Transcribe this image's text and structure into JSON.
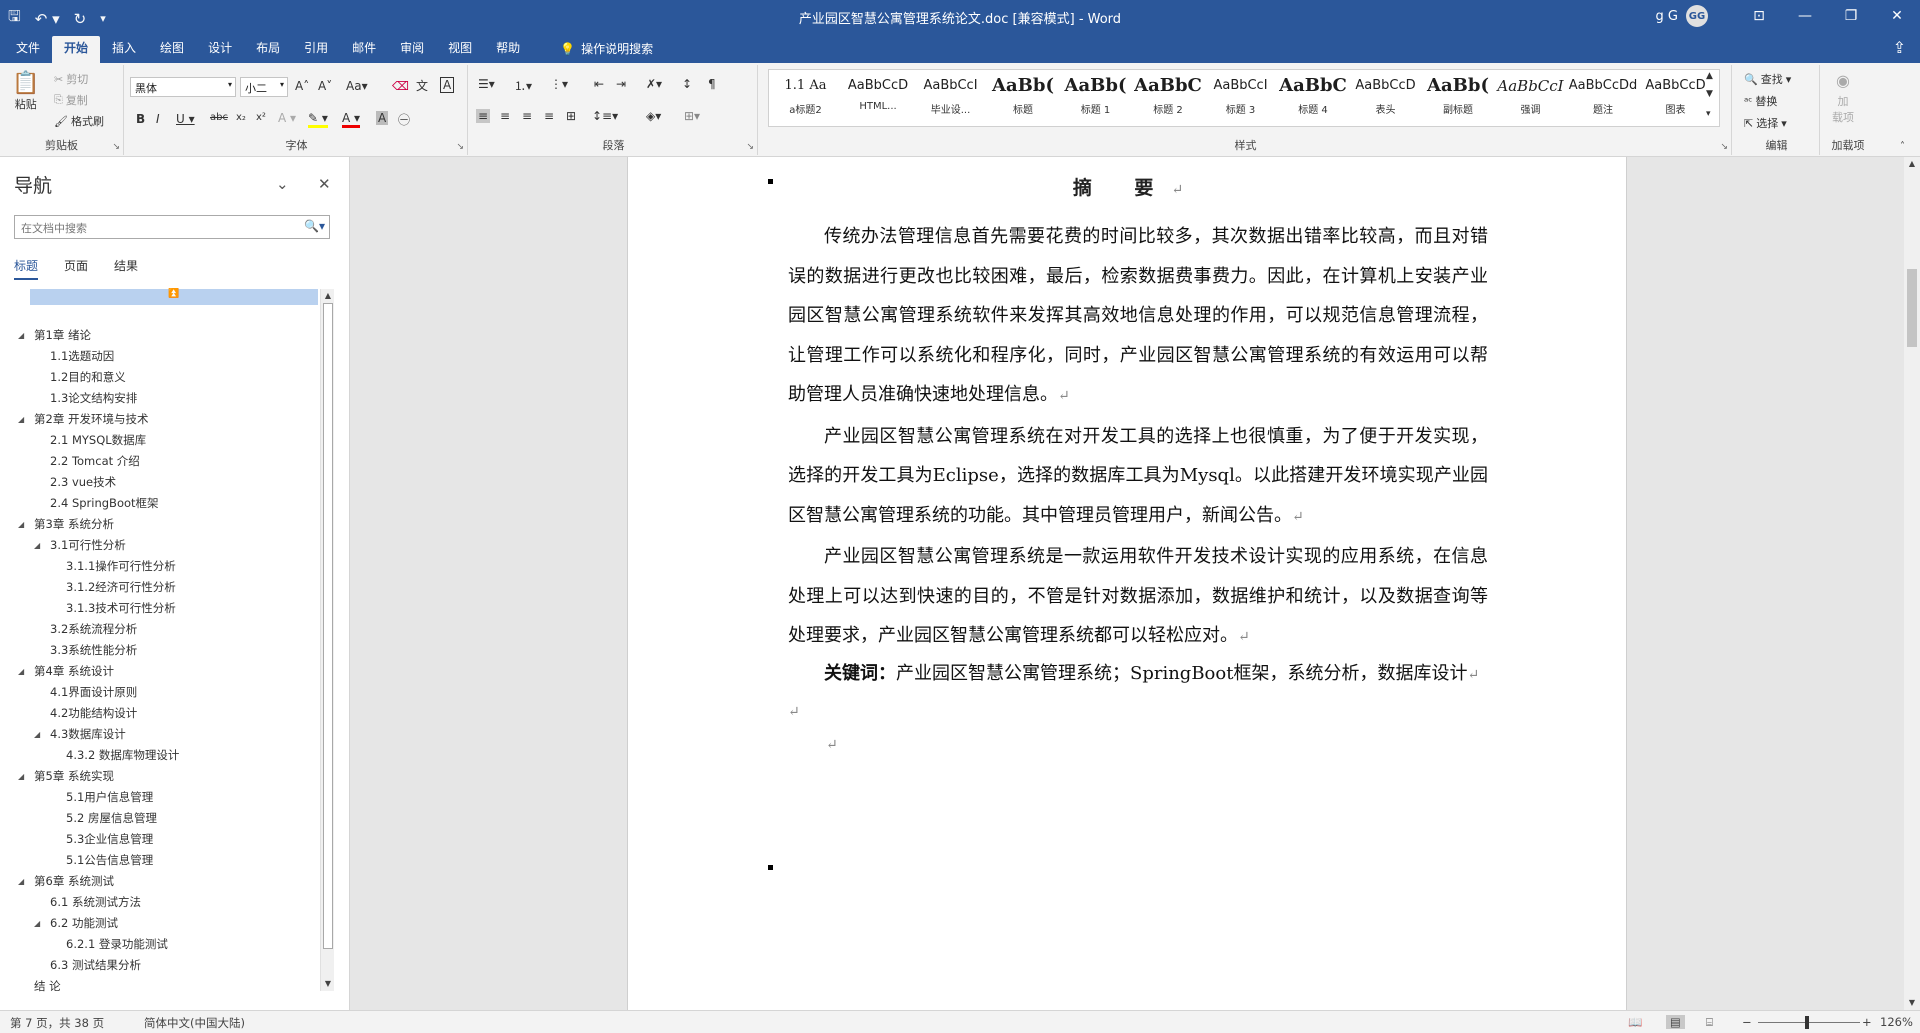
{
  "titlebar": {
    "title": "产业园区智慧公寓管理系统论文.doc [兼容模式] - Word",
    "user": "g G",
    "avatar": "GG",
    "qat": [
      "save-icon",
      "undo-icon",
      "redo-icon",
      "customize-icon"
    ],
    "window_buttons": [
      "ribbon-display-icon",
      "minimize-icon",
      "restore-icon",
      "close-icon"
    ]
  },
  "tabs": [
    "文件",
    "开始",
    "插入",
    "绘图",
    "设计",
    "布局",
    "引用",
    "邮件",
    "审阅",
    "视图",
    "帮助"
  ],
  "active_tab": "开始",
  "tell_me": "操作说明搜索",
  "ribbon": {
    "clipboard": {
      "label": "剪贴板",
      "paste": "粘贴",
      "cut": "剪切",
      "copy": "复制",
      "format_painter": "格式刷"
    },
    "font": {
      "label": "字体",
      "name": "黑体",
      "size": "小二"
    },
    "paragraph": {
      "label": "段落"
    },
    "styles": {
      "label": "样式",
      "items": [
        {
          "preview": "1.1 Aa",
          "name": "a标题2"
        },
        {
          "preview": "AaBbCcD",
          "name": "HTML..."
        },
        {
          "preview": "AaBbCcI",
          "name": "毕业设..."
        },
        {
          "preview": "AaBb(",
          "name": "标题"
        },
        {
          "preview": "AaBb(",
          "name": "标题 1"
        },
        {
          "preview": "AaBbC",
          "name": "标题 2"
        },
        {
          "preview": "AaBbCcI",
          "name": "标题 3"
        },
        {
          "preview": "AaBbC",
          "name": "标题 4"
        },
        {
          "preview": "AaBbCcD",
          "name": "表头"
        },
        {
          "preview": "AaBb(",
          "name": "副标题"
        },
        {
          "preview": "AaBbCcI",
          "name": "强调"
        },
        {
          "preview": "AaBbCcDd",
          "name": "题注"
        },
        {
          "preview": "AaBbCcD",
          "name": "图表"
        }
      ]
    },
    "editing": {
      "label": "编辑",
      "find": "查找",
      "replace": "替换",
      "select": "选择"
    },
    "addins": {
      "label": "加载项",
      "button": "加\n载项"
    }
  },
  "nav": {
    "title": "导航",
    "search_placeholder": "在文档中搜索",
    "tabs": [
      "标题",
      "页面",
      "结果"
    ],
    "active_tab": "标题",
    "items": [
      {
        "level": 1,
        "text": "第1章 绪论",
        "toggle": true
      },
      {
        "level": 2,
        "text": "1.1选题动因",
        "toggle": false
      },
      {
        "level": 2,
        "text": "1.2目的和意义",
        "toggle": false
      },
      {
        "level": 2,
        "text": "1.3论文结构安排",
        "toggle": false
      },
      {
        "level": 1,
        "text": "第2章 开发环境与技术",
        "toggle": true
      },
      {
        "level": 2,
        "text": "2.1 MYSQL数据库",
        "toggle": false
      },
      {
        "level": 2,
        "text": "2.2 Tomcat 介绍",
        "toggle": false
      },
      {
        "level": 2,
        "text": "2.3 vue技术",
        "toggle": false
      },
      {
        "level": 2,
        "text": "2.4 SpringBoot框架",
        "toggle": false
      },
      {
        "level": 1,
        "text": "第3章 系统分析",
        "toggle": true
      },
      {
        "level": 2,
        "text": "3.1可行性分析",
        "toggle": true
      },
      {
        "level": 3,
        "text": "3.1.1操作可行性分析",
        "toggle": false
      },
      {
        "level": 3,
        "text": "3.1.2经济可行性分析",
        "toggle": false
      },
      {
        "level": 3,
        "text": "3.1.3技术可行性分析",
        "toggle": false
      },
      {
        "level": 2,
        "text": "3.2系统流程分析",
        "toggle": false
      },
      {
        "level": 2,
        "text": "3.3系统性能分析",
        "toggle": false
      },
      {
        "level": 1,
        "text": "第4章 系统设计",
        "toggle": true
      },
      {
        "level": 2,
        "text": "4.1界面设计原则",
        "toggle": false
      },
      {
        "level": 2,
        "text": "4.2功能结构设计",
        "toggle": false
      },
      {
        "level": 2,
        "text": "4.3数据库设计",
        "toggle": true
      },
      {
        "level": 3,
        "text": "4.3.2 数据库物理设计",
        "toggle": false
      },
      {
        "level": 1,
        "text": "第5章 系统实现",
        "toggle": true
      },
      {
        "level": 3,
        "text": "5.1用户信息管理",
        "toggle": false
      },
      {
        "level": 3,
        "text": "5.2 房屋信息管理",
        "toggle": false
      },
      {
        "level": 3,
        "text": "5.3企业信息管理",
        "toggle": false
      },
      {
        "level": 3,
        "text": "5.1公告信息管理",
        "toggle": false
      },
      {
        "level": 1,
        "text": "第6章 系统测试",
        "toggle": true
      },
      {
        "level": 2,
        "text": "6.1 系统测试方法",
        "toggle": false
      },
      {
        "level": 2,
        "text": "6.2 功能测试",
        "toggle": true
      },
      {
        "level": 3,
        "text": "6.2.1 登录功能测试",
        "toggle": false
      },
      {
        "level": 2,
        "text": "6.3 测试结果分析",
        "toggle": false
      },
      {
        "level": 1,
        "text": "结  论",
        "toggle": false
      }
    ]
  },
  "document": {
    "heading": "摘  要",
    "paragraphs": [
      "传统办法管理信息首先需要花费的时间比较多，其次数据出错率比较高，而且对错误的数据进行更改也比较困难，最后，检索数据费事费力。因此，在计算机上安装产业园区智慧公寓管理系统软件来发挥其高效地信息处理的作用，可以规范信息管理流程，让管理工作可以系统化和程序化，同时，产业园区智慧公寓管理系统的有效运用可以帮助管理人员准确快速地处理信息。",
      "产业园区智慧公寓管理系统在对开发工具的选择上也很慎重，为了便于开发实现，选择的开发工具为Eclipse，选择的数据库工具为Mysql。以此搭建开发环境实现产业园区智慧公寓管理系统的功能。其中管理员管理用户，新闻公告。",
      "产业园区智慧公寓管理系统是一款运用软件开发技术设计实现的应用系统，在信息处理上可以达到快速的目的，不管是针对数据添加，数据维护和统计，以及数据查询等处理要求，产业园区智慧公寓管理系统都可以轻松应对。"
    ],
    "keywords_label": "关键词：",
    "keywords": "产业园区智慧公寓管理系统；SpringBoot框架，系统分析，数据库设计",
    "return_mark": "↵"
  },
  "status": {
    "page": "第 7 页，共 38 页",
    "language": "简体中文(中国大陆)",
    "zoom": "126%",
    "zoom_minus": "−",
    "zoom_plus": "+"
  }
}
